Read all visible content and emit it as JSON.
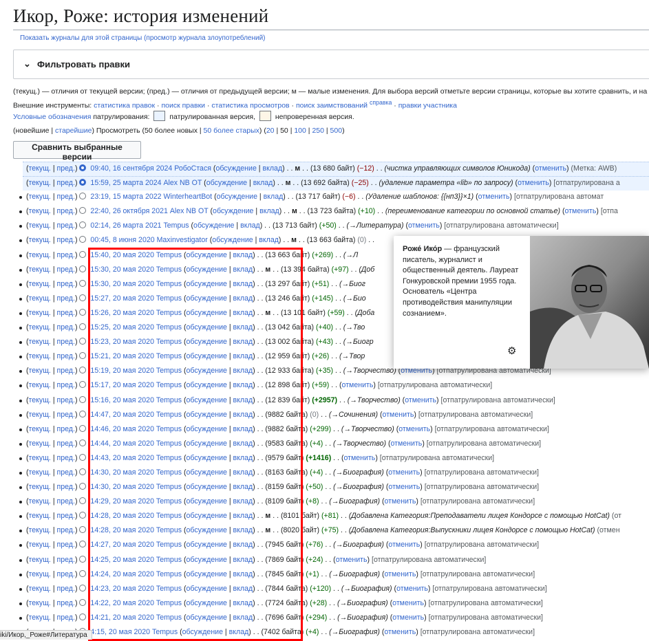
{
  "title": "Икор, Роже: история изменений",
  "sublinks": "Показать журналы для этой страницы (просмотр журнала злоупотреблений)",
  "filter_label": "Фильтровать правки",
  "legend": {
    "line1": "(текущ.) — отличия от текущей версии; (пред.) — отличия от предыдущей версии; м — малые изменения. Для выбора версий отметьте версии страницы, которые вы хотите сравнить, и на",
    "ext_prefix": "Внешние инструменты: ",
    "ext_links": [
      "статистика правок",
      "поиск правки",
      "статистика просмотров",
      "поиск заимствований",
      "правки участника"
    ],
    "help_sup": "справка",
    "patrol_link": "Условные обозначения",
    "patrol_text": " патрулирования: ",
    "patrolled": " патрулированная версия, ",
    "unpatrolled": " непроверенная версия."
  },
  "nav": {
    "open": "(новейшие | ",
    "oldest": "старейшие",
    "mid": ") Просмотреть (50 более новых | ",
    "older": "50 более старых",
    "close": ") (",
    "counts": [
      "20",
      "50",
      "100",
      "250",
      "500"
    ],
    "end": ")"
  },
  "compare_button": "Сравнить выбранные версии",
  "popup": {
    "name": "Роже́ Ико́р",
    "text": " — французский писатель, журналист и общественный деятель. Лауреат Гонкуровской премии 1955 года. Основатель «Центра противодействия манипуляции сознанием»."
  },
  "statusbar": "iki/Икор,_Роже#Литература",
  "rows": [
    {
      "unp": true,
      "sel": true,
      "date": "09:40, 16 сентября 2024",
      "user": "РобоСтася",
      "minor": true,
      "size": "(13 680 байт)",
      "diff": "(−12)",
      "dc": "neg",
      "comment": "(чистка управляющих символов Юникода)",
      "undo": true,
      "tag": "(Метка: AWB)"
    },
    {
      "unp": true,
      "sel": true,
      "date": "15:59, 25 марта 2024",
      "user": "Alex NB OT",
      "minor": true,
      "size": "(13 692 байта)",
      "diff": "(−25)",
      "dc": "neg",
      "comment": "(удаление параметра «lib» по запросу)",
      "undo": true,
      "tag": "[отпатрулирована а"
    },
    {
      "date": "23:19, 15 марта 2022",
      "user": "WinterheartBot",
      "minor": false,
      "size": "(13 717 байт)",
      "diff": "(−6)",
      "dc": "neg",
      "comment": "(Удаление шаблонов: {{нп3}}×1)",
      "undo": true,
      "tag": "[отпатрулирована автомат"
    },
    {
      "date": "22:40, 26 октября 2021",
      "user": "Alex NB OT",
      "minor": true,
      "size": "(13 723 байта)",
      "diff": "(+10)",
      "dc": "pos",
      "comment": "(переименование категории по основной статье)",
      "undo": true,
      "tag": "[отпа"
    },
    {
      "date": "02:14, 26 марта 2021",
      "user": "Tempus",
      "minor": false,
      "size": "(13 713 байт)",
      "diff": "(+50)",
      "dc": "pos",
      "comment": "(→Литература)",
      "undo": true,
      "tag": "[отпатрулирована автоматически]"
    },
    {
      "date": "00:45, 8 июня 2020",
      "user": "Maxinvestigator",
      "minor": true,
      "size": "(13 663 байта)",
      "diff": "(0)",
      "dc": "zero",
      "comment": "",
      "undo": false,
      "tag": ""
    },
    {
      "date": "15:40, 20 мая 2020",
      "user": "Tempus",
      "minor": false,
      "size": "(13 663 байт)",
      "diff": "(+269)",
      "dc": "pos",
      "comment": "(→Л",
      "undo": false,
      "tag": ""
    },
    {
      "date": "15:30, 20 мая 2020",
      "user": "Tempus",
      "minor": true,
      "size": "(13 394 байта)",
      "diff": "(+97)",
      "dc": "pos",
      "comment": "(Доб",
      "undo": false,
      "tag": ""
    },
    {
      "date": "15:30, 20 мая 2020",
      "user": "Tempus",
      "minor": false,
      "size": "(13 297 байт)",
      "diff": "(+51)",
      "dc": "pos",
      "comment": "(→Биог",
      "undo": false,
      "tag": ""
    },
    {
      "date": "15:27, 20 мая 2020",
      "user": "Tempus",
      "minor": false,
      "size": "(13 246 байт)",
      "diff": "(+145)",
      "dc": "pos",
      "comment": "(→Био",
      "undo": false,
      "tag": ""
    },
    {
      "date": "15:26, 20 мая 2020",
      "user": "Tempus",
      "minor": true,
      "size": "(13 101 байт)",
      "diff": "(+59)",
      "dc": "pos",
      "comment": "(Доба",
      "undo": false,
      "tag": ""
    },
    {
      "date": "15:25, 20 мая 2020",
      "user": "Tempus",
      "minor": false,
      "size": "(13 042 байта)",
      "diff": "(+40)",
      "dc": "pos",
      "comment": "(→Тво",
      "undo": false,
      "tag": ""
    },
    {
      "date": "15:23, 20 мая 2020",
      "user": "Tempus",
      "minor": false,
      "size": "(13 002 байта)",
      "diff": "(+43)",
      "dc": "pos",
      "comment": "(→Биогр",
      "undo": false,
      "tag": ""
    },
    {
      "date": "15:21, 20 мая 2020",
      "user": "Tempus",
      "minor": false,
      "size": "(12 959 байт)",
      "diff": "(+26)",
      "dc": "pos",
      "comment": "(→Твор",
      "undo": false,
      "tag": ""
    },
    {
      "date": "15:19, 20 мая 2020",
      "user": "Tempus",
      "minor": false,
      "size": "(12 933 байта)",
      "diff": "(+35)",
      "dc": "pos",
      "comment": "(→Творчество)",
      "undo": true,
      "tag": "[отпатрулирована автоматически]"
    },
    {
      "date": "15:17, 20 мая 2020",
      "user": "Tempus",
      "minor": false,
      "size": "(12 898 байт)",
      "diff": "(+59)",
      "dc": "pos",
      "comment": "",
      "undo": true,
      "tag": "[отпатрулирована автоматически]"
    },
    {
      "date": "15:16, 20 мая 2020",
      "user": "Tempus",
      "minor": false,
      "size": "(12 839 байт)",
      "diff": "(+2957)",
      "dc": "bigpos",
      "comment": "(→Творчество)",
      "undo": true,
      "tag": "[отпатрулирована автоматически]"
    },
    {
      "date": "14:47, 20 мая 2020",
      "user": "Tempus",
      "minor": false,
      "size": "(9882 байта)",
      "diff": "(0)",
      "dc": "zero",
      "comment": "(→Сочинения)",
      "undo": true,
      "tag": "[отпатрулирована автоматически]"
    },
    {
      "date": "14:46, 20 мая 2020",
      "user": "Tempus",
      "minor": false,
      "size": "(9882 байта)",
      "diff": "(+299)",
      "dc": "pos",
      "comment": "(→Творчество)",
      "undo": true,
      "tag": "[отпатрулирована автоматически]"
    },
    {
      "date": "14:44, 20 мая 2020",
      "user": "Tempus",
      "minor": false,
      "size": "(9583 байта)",
      "diff": "(+4)",
      "dc": "pos",
      "comment": "(→Творчество)",
      "undo": true,
      "tag": "[отпатрулирована автоматически]"
    },
    {
      "date": "14:43, 20 мая 2020",
      "user": "Tempus",
      "minor": false,
      "size": "(9579 байт)",
      "diff": "(+1416)",
      "dc": "bigpos",
      "comment": "",
      "undo": true,
      "tag": "[отпатрулирована автоматически]"
    },
    {
      "date": "14:30, 20 мая 2020",
      "user": "Tempus",
      "minor": false,
      "size": "(8163 байта)",
      "diff": "(+4)",
      "dc": "pos",
      "comment": "(→Биография)",
      "undo": true,
      "tag": "[отпатрулирована автоматически]"
    },
    {
      "date": "14:30, 20 мая 2020",
      "user": "Tempus",
      "minor": false,
      "size": "(8159 байт)",
      "diff": "(+50)",
      "dc": "pos",
      "comment": "(→Биография)",
      "undo": true,
      "tag": "[отпатрулирована автоматически]"
    },
    {
      "date": "14:29, 20 мая 2020",
      "user": "Tempus",
      "minor": false,
      "size": "(8109 байт)",
      "diff": "(+8)",
      "dc": "pos",
      "comment": "(→Биография)",
      "undo": true,
      "tag": "[отпатрулирована автоматически]"
    },
    {
      "date": "14:28, 20 мая 2020",
      "user": "Tempus",
      "minor": true,
      "size": "(8101 байт)",
      "diff": "(+81)",
      "dc": "pos",
      "comment": "(Добавлена Категория:Преподаватели лицея Кондорсе с помощью HotCat)",
      "undo": false,
      "tag": "(от"
    },
    {
      "date": "14:28, 20 мая 2020",
      "user": "Tempus",
      "minor": true,
      "size": "(8020 байт)",
      "diff": "(+75)",
      "dc": "pos",
      "comment": "(Добавлена Категория:Выпускники лицея Кондорсе с помощью HotCat)",
      "undo": false,
      "tag": "(отмен"
    },
    {
      "date": "14:27, 20 мая 2020",
      "user": "Tempus",
      "minor": false,
      "size": "(7945 байт)",
      "diff": "(+76)",
      "dc": "pos",
      "comment": "(→Биография)",
      "undo": true,
      "tag": "[отпатрулирована автоматически]"
    },
    {
      "date": "14:25, 20 мая 2020",
      "user": "Tempus",
      "minor": false,
      "size": "(7869 байт)",
      "diff": "(+24)",
      "dc": "pos",
      "comment": "",
      "undo": true,
      "tag": "[отпатрулирована автоматически]"
    },
    {
      "date": "14:24, 20 мая 2020",
      "user": "Tempus",
      "minor": false,
      "size": "(7845 байт)",
      "diff": "(+1)",
      "dc": "pos",
      "comment": "(→Биография)",
      "undo": true,
      "tag": "[отпатрулирована автоматически]"
    },
    {
      "date": "14:23, 20 мая 2020",
      "user": "Tempus",
      "minor": false,
      "size": "(7844 байта)",
      "diff": "(+120)",
      "dc": "pos",
      "comment": "(→Биография)",
      "undo": true,
      "tag": "[отпатрулирована автоматически]"
    },
    {
      "date": "14:22, 20 мая 2020",
      "user": "Tempus",
      "minor": false,
      "size": "(7724 байта)",
      "diff": "(+28)",
      "dc": "pos",
      "comment": "(→Биография)",
      "undo": true,
      "tag": "[отпатрулирована автоматически]"
    },
    {
      "date": "14:21, 20 мая 2020",
      "user": "Tempus",
      "minor": false,
      "size": "(7696 байт)",
      "diff": "(+294)",
      "dc": "pos",
      "comment": "(→Биография)",
      "undo": true,
      "tag": "[отпатрулирована автоматически]"
    },
    {
      "date": "4:15, 20 мая 2020",
      "user": "Tempus",
      "minor": false,
      "size": "(7402 байта)",
      "diff": "(+4)",
      "dc": "pos",
      "comment": "(→Биография)",
      "undo": true,
      "tag": "[отпатрулирована автоматически]"
    }
  ],
  "row_text": {
    "cur": "текущ.",
    "prev": "пред.",
    "talk": "обсуждение",
    "contribs": "вклад",
    "minor_mark": "м",
    "undo": "отменить"
  }
}
